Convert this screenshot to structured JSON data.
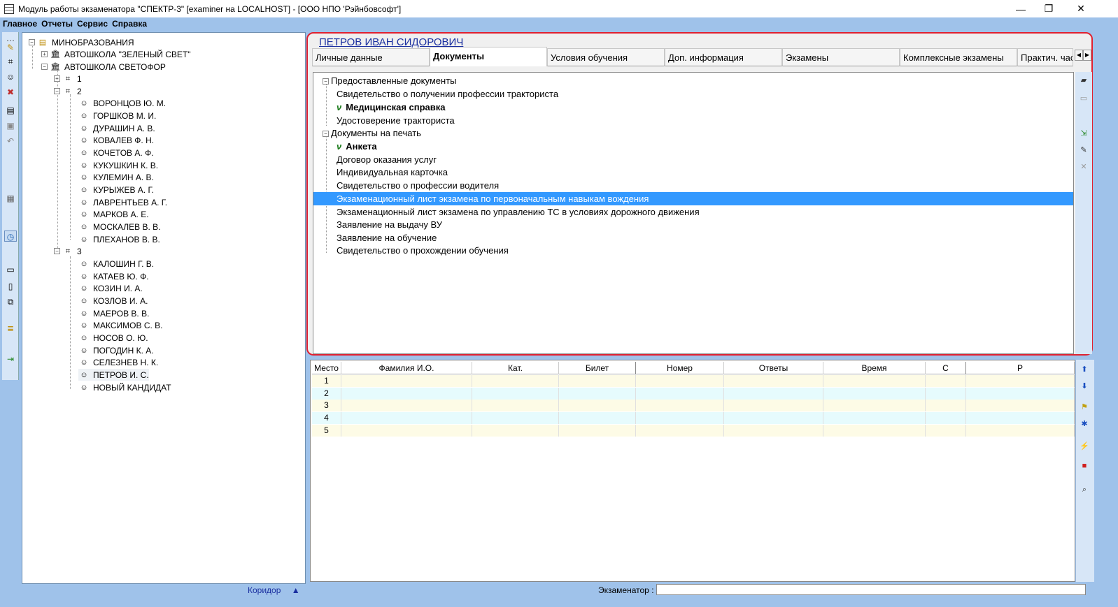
{
  "window": {
    "title": "Модуль работы экзаменатора \"СПЕКТР-3\" [examiner на LOCALHOST] - [ООО НПО 'Рэйнбовсофт']",
    "minimize": "—",
    "restore": "❐",
    "close": "✕"
  },
  "menu": [
    "Главное",
    "Отчеты",
    "Сервис",
    "Справка"
  ],
  "tree": {
    "root": "МИНОБРАЗОВАНИЯ",
    "schools": [
      "АВТОШКОЛА \"ЗЕЛЕНЫЙ СВЕТ\"",
      "АВТОШКОЛА СВЕТОФОР"
    ],
    "groups": [
      "1",
      "2",
      "3"
    ],
    "group2": [
      "ВОРОНЦОВ Ю. М.",
      "ГОРШКОВ М. И.",
      "ДУРАШИН А. В.",
      "КОВАЛЕВ Ф. Н.",
      "КОЧЕТОВ А. Ф.",
      "КУКУШКИН К. В.",
      "КУЛЕМИН А. В.",
      "КУРЫЖЕВ А. Г.",
      "ЛАВРЕНТЬЕВ А. Г.",
      "МАРКОВ А. Е.",
      "МОСКАЛЕВ В. В.",
      "ПЛЕХАНОВ В. В."
    ],
    "group3": [
      "КАЛОШИН Г. В.",
      "КАТАЕВ Ю. Ф.",
      "КОЗИН И. А.",
      "КОЗЛОВ И. А.",
      "МАЕРОВ В. В.",
      "МАКСИМОВ С. В.",
      "НОСОВ О. Ю.",
      "ПОГОДИН К. А.",
      "СЕЛЕЗНЕВ Н. К.",
      "ПЕТРОВ И. С.",
      "НОВЫЙ КАНДИДАТ"
    ]
  },
  "person_name": "ПЕТРОВ ИВАН СИДОРОВИЧ",
  "tabs": [
    "Личные данные",
    "Документы",
    "Условия обучения",
    "Доп. информация",
    "Экзамены",
    "Комплексные экзамены",
    "Практич. часть"
  ],
  "active_tab": "Документы",
  "documents": {
    "provided_header": "Предоставленные документы",
    "provided": [
      {
        "label": "Свидетельство о получении профессии тракториста",
        "checked": false
      },
      {
        "label": "Медицинская справка",
        "checked": true
      },
      {
        "label": "Удостоверение тракториста",
        "checked": false
      }
    ],
    "print_header": "Документы на печать",
    "print": [
      {
        "label": "Анкета",
        "checked": true
      },
      {
        "label": "Договор оказания услуг",
        "checked": false
      },
      {
        "label": "Индивидуальная карточка",
        "checked": false
      },
      {
        "label": "Свидетельство о профессии водителя",
        "checked": false
      },
      {
        "label": "Экзаменационный лист экзамена по первоначальным навыкам вождения",
        "checked": false,
        "selected": true
      },
      {
        "label": "Экзаменационный лист экзамена по управлению ТС в условиях дорожного движения",
        "checked": false
      },
      {
        "label": "Заявление на выдачу ВУ",
        "checked": false
      },
      {
        "label": "Заявление на обучение",
        "checked": false
      },
      {
        "label": "Свидетельство о прохождении обучения",
        "checked": false
      }
    ],
    "check_mark": "ν"
  },
  "grid": {
    "columns": [
      "Место",
      "Фамилия И.О.",
      "Кат.",
      "Билет",
      "Номер",
      "Ответы",
      "Время",
      "С",
      "Р"
    ],
    "rows": [
      "1",
      "2",
      "3",
      "4",
      "5"
    ]
  },
  "status": {
    "corridor": "Коридор",
    "examiner_label": "Экзаменатор :"
  },
  "colors": {
    "selection": "#3399ff",
    "highlight_border": "#e02030",
    "row_yellow": "#fdfbe6",
    "row_cyan": "#e6fbfd"
  }
}
